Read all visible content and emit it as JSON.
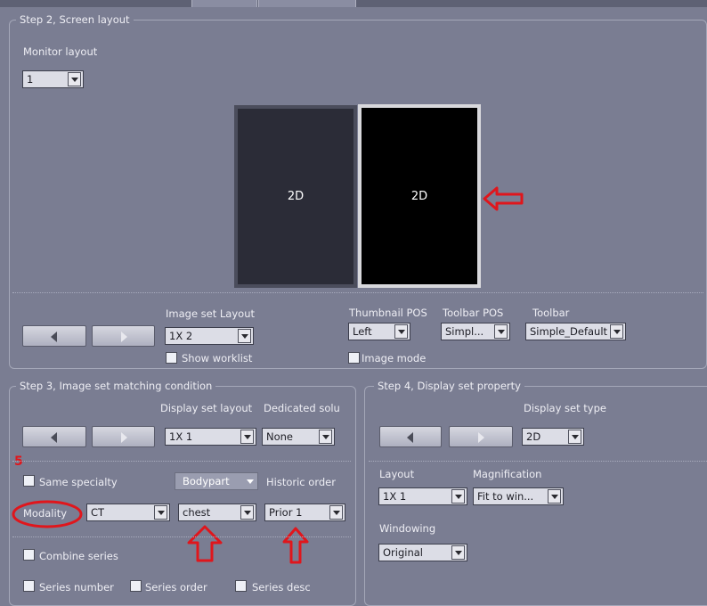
{
  "step2": {
    "legend": "Step 2, Screen layout",
    "monitor_layout_label": "Monitor layout",
    "monitor_layout_value": "1",
    "monitors": [
      {
        "label": "2D",
        "selected": false
      },
      {
        "label": "2D",
        "selected": true
      }
    ],
    "image_set_layout_label": "Image set Layout",
    "image_set_layout_value": "1X 2",
    "show_worklist_label": "Show worklist",
    "thumbnail_pos_label": "Thumbnail POS",
    "thumbnail_pos_value": "Left",
    "image_mode_label": "Image mode",
    "toolbar_pos_label": "Toolbar POS",
    "toolbar_pos_value": "Simpl...",
    "toolbar_label": "Toolbar",
    "toolbar_value": "Simple_Default"
  },
  "step3": {
    "legend": "Step 3, Image set matching condition",
    "display_set_layout_label": "Display set layout",
    "display_set_layout_value": "1X 1",
    "dedicated_label": "Dedicated solu",
    "dedicated_value": "None",
    "annotation_number": "5",
    "same_specialty_label": "Same specialty",
    "bodypart_value": "Bodypart",
    "historic_order_label": "Historic order",
    "modality_label": "Modality",
    "modality_value": "CT",
    "bodypart_select_value": "chest",
    "historic_order_value": "Prior 1",
    "combine_series_label": "Combine series",
    "series_number_label": "Series number",
    "series_order_label": "Series order",
    "series_desc_label": "Series desc"
  },
  "step4": {
    "legend": "Step 4, Display set property",
    "display_set_type_label": "Display set type",
    "display_set_type_value": "2D",
    "layout_label": "Layout",
    "layout_value": "1X 1",
    "magnification_label": "Magnification",
    "magnification_value": "Fit to win...",
    "windowing_label": "Windowing",
    "windowing_value": "Original"
  },
  "colors": {
    "annotation_red": "#e0161c",
    "background": "#7a7d92"
  }
}
